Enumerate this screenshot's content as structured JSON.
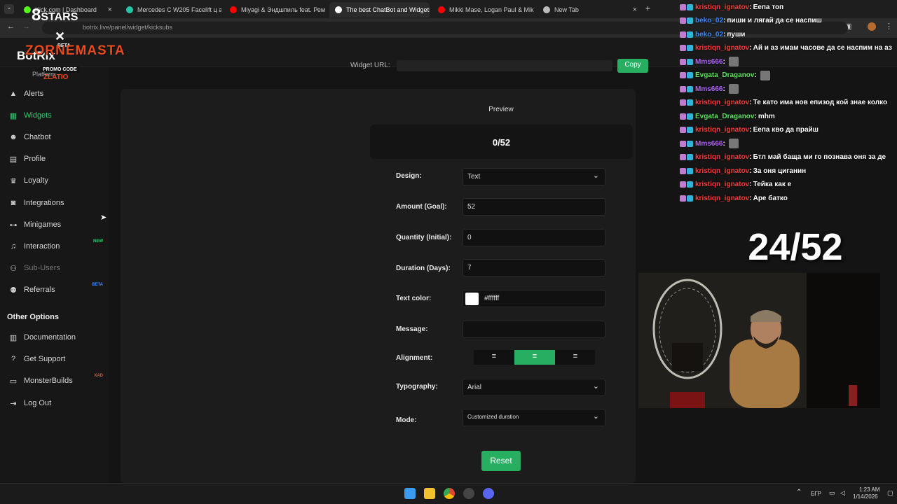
{
  "browser": {
    "tabs": [
      {
        "label": "Kick.com | Dashboard",
        "icon_color": "#53fc18"
      },
      {
        "label": "Mercedes C W205 Facelift ц ал",
        "icon_color": "#27c4a8"
      },
      {
        "label": "Miyagi & Эндшпиль feat. Рем",
        "icon_color": "#ff0000"
      },
      {
        "label": "The best ChatBot and Widgets",
        "icon_color": "#ffffff"
      },
      {
        "label": "Mikki Mase, Logan Paul & Mik",
        "icon_color": "#ff0000"
      },
      {
        "label": "New Tab",
        "icon_color": "#bbbbbb"
      }
    ],
    "new_tab_symbol": "+",
    "tab_close_symbol": "×",
    "url": "botrix.live/panel/widget/kicksubs"
  },
  "logo": {
    "stars": "STARS",
    "beta": "BETA",
    "brand": "BotRix",
    "main": "ZORNEMASTA",
    "promo": "PROMO CODE",
    "code": "ZLATIO",
    "subtitle": "Platform"
  },
  "sidebar": {
    "items": [
      {
        "label": "Alerts",
        "icon": "warning-icon",
        "glyph": "▲",
        "badge": ""
      },
      {
        "label": "Widgets",
        "icon": "grid-icon",
        "glyph": "▦",
        "badge": ""
      },
      {
        "label": "Chatbot",
        "icon": "robot-icon",
        "glyph": "☻",
        "badge": ""
      },
      {
        "label": "Profile",
        "icon": "id-card-icon",
        "glyph": "▤",
        "badge": ""
      },
      {
        "label": "Loyalty",
        "icon": "trophy-icon",
        "glyph": "♛",
        "badge": ""
      },
      {
        "label": "Integrations",
        "icon": "integrations-icon",
        "glyph": "◙",
        "badge": ""
      },
      {
        "label": "Minigames",
        "icon": "gamepad-icon",
        "glyph": "⊶",
        "badge": ""
      },
      {
        "label": "Interaction",
        "icon": "music-icon",
        "glyph": "♫",
        "badge": "NEW"
      },
      {
        "label": "Sub-Users",
        "icon": "users-icon",
        "glyph": "⚇",
        "badge": ""
      },
      {
        "label": "Referrals",
        "icon": "referrals-icon",
        "glyph": "⚉",
        "badge": "BETA"
      }
    ],
    "other_options_title": "Other Options",
    "other_items": [
      {
        "label": "Documentation",
        "icon": "book-icon",
        "glyph": "▥",
        "badge": ""
      },
      {
        "label": "Get Support",
        "icon": "question-icon",
        "glyph": "?",
        "badge": ""
      },
      {
        "label": "MonsterBuilds",
        "icon": "laptop-icon",
        "glyph": "▭",
        "badge": "XAD"
      },
      {
        "label": "Log Out",
        "icon": "logout-icon",
        "glyph": "⇥",
        "badge": ""
      }
    ]
  },
  "widget_url": {
    "label": "Widget URL:",
    "copy_label": "Copy"
  },
  "preview": {
    "label": "Preview",
    "value": "0/52"
  },
  "form": {
    "design": {
      "label": "Design:",
      "value": "Text"
    },
    "amount": {
      "label": "Amount (Goal):",
      "value": "52"
    },
    "quantity": {
      "label": "Quantity (Initial):",
      "value": "0"
    },
    "duration": {
      "label": "Duration (Days):",
      "value": "7"
    },
    "text_color": {
      "label": "Text color:",
      "value": "#ffffff"
    },
    "message": {
      "label": "Message:",
      "value": ""
    },
    "alignment": {
      "label": "Alignment:",
      "options": [
        "≡",
        "≡",
        "≡"
      ],
      "selected": 1
    },
    "typography": {
      "label": "Typography:",
      "value": "Arial"
    },
    "mode": {
      "label": "Mode:",
      "value": "Customized duration"
    }
  },
  "reset_label": "Reset",
  "chat": [
    {
      "user": "kristiqn_ignatov",
      "color": "#ff3b3b",
      "msg": "Еепа топ",
      "emote": false
    },
    {
      "user": "beko_02",
      "color": "#3b8bff",
      "msg": "пиши и лягай да се наспиш",
      "emote": false
    },
    {
      "user": "beko_02",
      "color": "#3b8bff",
      "msg": "пуши",
      "emote": false
    },
    {
      "user": "kristiqn_ignatov",
      "color": "#ff3b3b",
      "msg": "Ай и аз имам часове да се наспим на аз",
      "emote": false
    },
    {
      "user": "Mms666",
      "color": "#b565ff",
      "msg": "",
      "emote": true
    },
    {
      "user": "Evgata_Draganov",
      "color": "#5be35b",
      "msg": "",
      "emote": true
    },
    {
      "user": "Mms666",
      "color": "#b565ff",
      "msg": "",
      "emote": true
    },
    {
      "user": "kristiqn_ignatov",
      "color": "#ff3b3b",
      "msg": "Те като има нов епизод кой знае колко",
      "emote": false
    },
    {
      "user": "Evgata_Draganov",
      "color": "#5be35b",
      "msg": "mhm",
      "emote": false
    },
    {
      "user": "kristiqn_ignatov",
      "color": "#ff3b3b",
      "msg": "Еепа кво да прайш",
      "emote": false
    },
    {
      "user": "Mms666",
      "color": "#b565ff",
      "msg": "",
      "emote": true
    },
    {
      "user": "kristiqn_ignatov",
      "color": "#ff3b3b",
      "msg": "Бтл май баща ми го познава оня за де",
      "emote": false
    },
    {
      "user": "kristiqn_ignatov",
      "color": "#ff3b3b",
      "msg": "За оня циганин",
      "emote": false
    },
    {
      "user": "kristiqn_ignatov",
      "color": "#ff3b3b",
      "msg": "Тейка как е",
      "emote": false
    },
    {
      "user": "kristiqn_ignatov",
      "color": "#ff3b3b",
      "msg": "Аре батко",
      "emote": false
    }
  ],
  "sub_counter": "24/52",
  "taskbar": {
    "time": "1:23 AM",
    "date": "1/14/2026",
    "lang": "БГР",
    "icons": [
      "windows-start-icon",
      "file-explorer-icon",
      "chrome-icon",
      "obs-icon",
      "discord-icon"
    ]
  },
  "colors": {
    "accent": "#27ae60",
    "background": "#141414",
    "panel": "#1c1c1c"
  }
}
